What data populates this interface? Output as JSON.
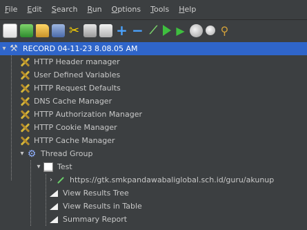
{
  "menu": {
    "items": [
      "File",
      "Edit",
      "Search",
      "Run",
      "Options",
      "Tools",
      "Help"
    ]
  },
  "toolbar": {
    "icons": [
      "new-icon",
      "templates-icon",
      "open-icon",
      "save-icon",
      "cut-icon",
      "copy-icon",
      "paste-icon",
      "expand-icon",
      "collapse-icon",
      "toggle-icon",
      "start-icon",
      "start-no-pauses-icon",
      "stop-icon",
      "shutdown-icon",
      "clear-icon"
    ]
  },
  "tree": {
    "root": "RECORD 04-11-23 8.08.05 AM",
    "items": [
      {
        "label": "HTTP Header manager"
      },
      {
        "label": "User Defined Variables"
      },
      {
        "label": "HTTP Request Defaults"
      },
      {
        "label": "DNS Cache Manager"
      },
      {
        "label": "HTTP Authorization Manager"
      },
      {
        "label": "HTTP Cookie Manager"
      },
      {
        "label": "HTTP Cache Manager"
      },
      {
        "label": "Thread Group"
      },
      {
        "label": "Test"
      },
      {
        "label": "https://gtk.smkpandawabaliglobal.sch.id/guru/akunup"
      },
      {
        "label": "View Results Tree"
      },
      {
        "label": "View Results in Table"
      },
      {
        "label": "Summary Report"
      }
    ]
  }
}
